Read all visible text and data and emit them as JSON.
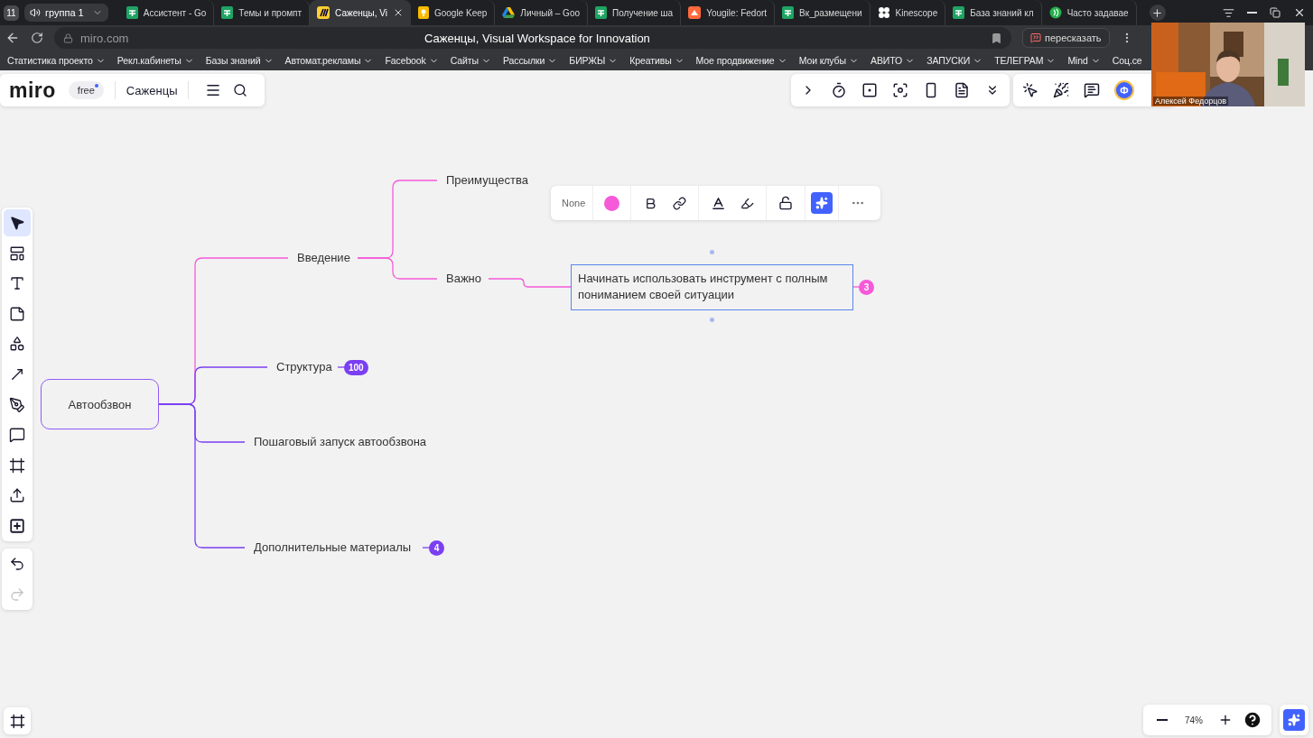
{
  "browser": {
    "workspace_count": "11",
    "group": "группа 1",
    "tabs": [
      {
        "title": "Ассистент - Go",
        "kind": "sheet",
        "selected": false
      },
      {
        "title": "Темы и промпт",
        "kind": "sheet",
        "selected": false
      },
      {
        "title": "Саженцы, Vi",
        "kind": "miro",
        "selected": true
      },
      {
        "title": "Google Keep",
        "kind": "keep",
        "selected": false
      },
      {
        "title": "Личный – Goo",
        "kind": "drive",
        "selected": false
      },
      {
        "title": "Получение ша",
        "kind": "sheet",
        "selected": false
      },
      {
        "title": "Yougile: Fedort",
        "kind": "yougile",
        "selected": false
      },
      {
        "title": "Вк_размещени",
        "kind": "sheet",
        "selected": false
      },
      {
        "title": "Kinescope",
        "kind": "kinescope",
        "selected": false
      },
      {
        "title": "База знаний кл",
        "kind": "sheet",
        "selected": false
      },
      {
        "title": "Часто задавае",
        "kind": "chat",
        "selected": false
      }
    ],
    "address": "miro.com",
    "page_title": "Саженцы, Visual Workspace for Innovation",
    "summarize_button": "пересказать",
    "bookmarks": [
      "Статистика проекто",
      "Рекл.кабинеты",
      "Базы знаний",
      "Автомат.рекламы",
      "Facebook",
      "Сайты",
      "Рассылки",
      "БИРЖЫ",
      "Креативы",
      "Мое продвижение",
      "Мои клубы",
      "АВИТО",
      "ЗАПУСКИ",
      "ТЕЛЕГРАМ",
      "Mind",
      "Соц.се"
    ]
  },
  "video_call": {
    "name": "Алексей Федорцов"
  },
  "board": {
    "logo": "miro",
    "plan": "free",
    "name": "Саженцы",
    "avatar_initial": "Ф"
  },
  "tools": [
    {
      "kind": "select",
      "selected": true
    },
    {
      "kind": "templates",
      "selected": false
    },
    {
      "kind": "text",
      "selected": false
    },
    {
      "kind": "sticky",
      "selected": false
    },
    {
      "kind": "shapes",
      "selected": false
    },
    {
      "kind": "line",
      "selected": false
    },
    {
      "kind": "pen",
      "selected": false
    },
    {
      "kind": "comment",
      "selected": false
    },
    {
      "kind": "frame",
      "selected": false
    },
    {
      "kind": "upload",
      "selected": false
    },
    {
      "kind": "add",
      "selected": false
    }
  ],
  "history": [
    {
      "kind": "undo",
      "disabled": false
    },
    {
      "kind": "redo",
      "disabled": true
    }
  ],
  "format_toolbar": {
    "font": "None"
  },
  "mindmap": {
    "root": {
      "label": "Автообзвон",
      "color": "#8e5cf7",
      "selected": false,
      "children": [
        {
          "label": "Введение",
          "kind": "text",
          "color": "#f55ad9",
          "selected": false,
          "children": [
            {
              "label": "Преимущества",
              "kind": "text",
              "selected": false
            },
            {
              "label": "Важно",
              "kind": "text",
              "selected": false,
              "children": [
                {
                  "label": "Начинать использовать инструмент с полным пониманием своей ситуации",
                  "kind": "card",
                  "selected": true,
                  "badge": "3"
                }
              ]
            }
          ]
        },
        {
          "label": "Структура",
          "kind": "text",
          "color": "#7b3ff2",
          "selected": false,
          "badge": "100"
        },
        {
          "label": "Пошаговый запуск автообзвона",
          "kind": "text",
          "color": "#7b3ff2",
          "selected": false
        },
        {
          "label": "Дополнительные материалы",
          "kind": "text",
          "color": "#7b3ff2",
          "selected": false,
          "badge": "4"
        }
      ]
    }
  },
  "zoom": "74%"
}
